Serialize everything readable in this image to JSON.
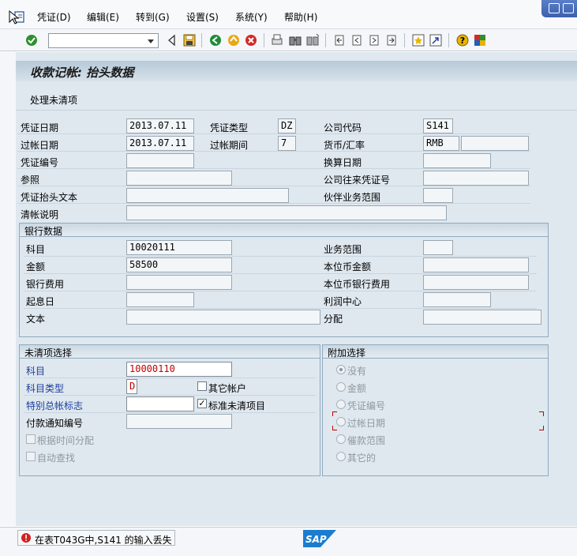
{
  "menu": [
    "凭证(D)",
    "编辑(E)",
    "转到(G)",
    "设置(S)",
    "系统(Y)",
    "帮助(H)"
  ],
  "toolbar": {
    "command_value": ""
  },
  "title": "收款记帐: 抬头数据",
  "app_toolbar": {
    "process_open": "处理未清项"
  },
  "header": {
    "doc_date_label": "凭证日期",
    "doc_date": "2013.07.11",
    "doc_type_label": "凭证类型",
    "doc_type": "DZ",
    "company_code_label": "公司代码",
    "company_code": "S141",
    "posting_date_label": "过帐日期",
    "posting_date": "2013.07.11",
    "period_label": "过帐期间",
    "period": "7",
    "currency_label": "货币/汇率",
    "currency": "RMB",
    "rate": "",
    "doc_number_label": "凭证编号",
    "doc_number": "",
    "translation_date_label": "换算日期",
    "translation_date": "",
    "reference_label": "参照",
    "reference": "",
    "cross_cc_label": "公司往来凭证号",
    "cross_cc": "",
    "header_text_label": "凭证抬头文本",
    "header_text": "",
    "partner_ba_label": "伙伴业务范围",
    "partner_ba": "",
    "clearing_text_label": "清帐说明",
    "clearing_text": ""
  },
  "bank": {
    "title": "银行数据",
    "account_label": "科目",
    "account": "10020111",
    "business_area_label": "业务范围",
    "business_area": "",
    "amount_label": "金额",
    "amount": "58500",
    "lc_amount_label": "本位币金额",
    "lc_amount": "",
    "bank_charges_label": "银行费用",
    "bank_charges": "",
    "lc_bank_charges_label": "本位币银行费用",
    "lc_bank_charges": "",
    "value_date_label": "起息日",
    "value_date": "",
    "profit_center_label": "利润中心",
    "profit_center": "",
    "text_label": "文本",
    "text": "",
    "assignment_label": "分配",
    "assignment": ""
  },
  "open_items": {
    "title": "未清项选择",
    "account_label": "科目",
    "account": "10000110",
    "account_type_label": "科目类型",
    "account_type": "D",
    "other_accounts_label": "其它帐户",
    "other_accounts_checked": false,
    "special_gl_label": "特别总帐标志",
    "special_gl": "",
    "standard_oi_label": "标准未清项目",
    "standard_oi_checked": true,
    "pa_number_label": "付款通知编号",
    "pa_number": "",
    "distribute_by_age_label": "根据时间分配",
    "auto_search_label": "自动查找"
  },
  "additional": {
    "title": "附加选择",
    "options": [
      "没有",
      "金额",
      "凭证编号",
      "过帐日期",
      "催款范围",
      "其它的"
    ],
    "selected": "没有"
  },
  "status": {
    "message": "在表T043G中,S141 的输入丢失",
    "type": "error"
  },
  "logo": "SAP",
  "colors": {
    "error": "#d32020",
    "label_blue": "#1c3d9c",
    "title_grad": "#b6c9d8"
  }
}
